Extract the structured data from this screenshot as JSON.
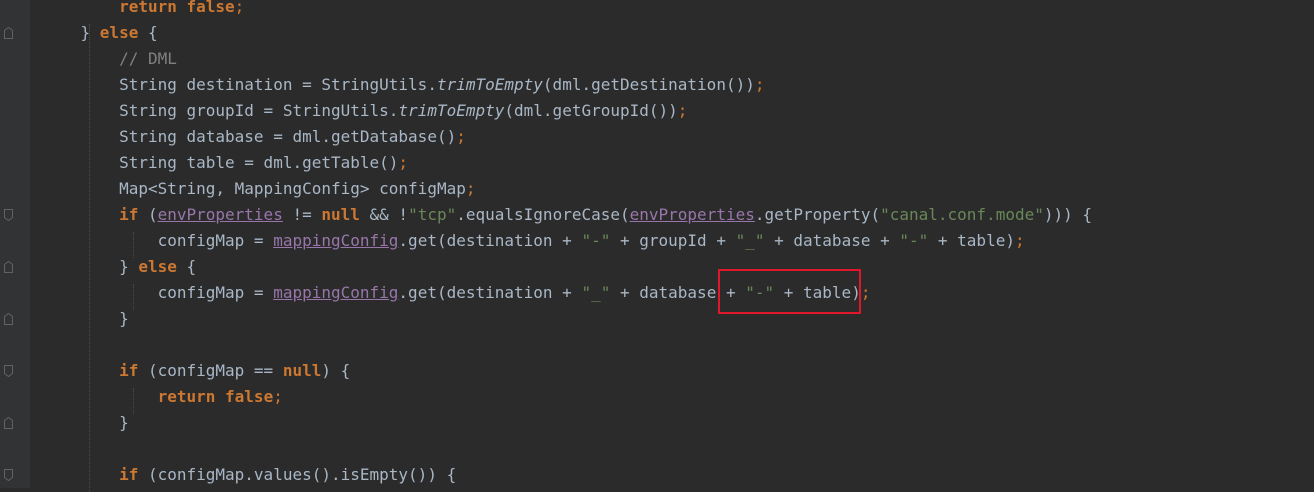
{
  "lines": [
    [
      {
        "t": "        "
      },
      {
        "t": "return",
        "c": "kw"
      },
      {
        "t": " "
      },
      {
        "t": "false",
        "c": "kw"
      },
      {
        "t": ";",
        "c": "semi"
      }
    ],
    [
      {
        "t": "    } "
      },
      {
        "t": "else",
        "c": "kw"
      },
      {
        "t": " {"
      }
    ],
    [
      {
        "t": "        "
      },
      {
        "t": "// DML",
        "c": "com"
      }
    ],
    [
      {
        "t": "        String destination = StringUtils."
      },
      {
        "t": "trimToEmpty",
        "c": "it"
      },
      {
        "t": "(dml.getDestination())"
      },
      {
        "t": ";",
        "c": "semi"
      }
    ],
    [
      {
        "t": "        String groupId = StringUtils."
      },
      {
        "t": "trimToEmpty",
        "c": "it"
      },
      {
        "t": "(dml.getGroupId())"
      },
      {
        "t": ";",
        "c": "semi"
      }
    ],
    [
      {
        "t": "        String database = dml.getDatabase()"
      },
      {
        "t": ";",
        "c": "semi"
      }
    ],
    [
      {
        "t": "        String table = dml.getTable()"
      },
      {
        "t": ";",
        "c": "semi"
      }
    ],
    [
      {
        "t": "        Map<String, MappingConfig> configMap"
      },
      {
        "t": ";",
        "c": "semi"
      }
    ],
    [
      {
        "t": "        "
      },
      {
        "t": "if",
        "c": "kw"
      },
      {
        "t": " ("
      },
      {
        "t": "envProperties",
        "c": "fld"
      },
      {
        "t": " != "
      },
      {
        "t": "null",
        "c": "kw"
      },
      {
        "t": " && !"
      },
      {
        "t": "\"tcp\"",
        "c": "str"
      },
      {
        "t": ".equalsIgnoreCase("
      },
      {
        "t": "envProperties",
        "c": "fld"
      },
      {
        "t": ".getProperty("
      },
      {
        "t": "\"canal.conf.mode\"",
        "c": "str"
      },
      {
        "t": "))) {"
      }
    ],
    [
      {
        "t": "            configMap = "
      },
      {
        "t": "mappingConfig",
        "c": "fld"
      },
      {
        "t": ".get(destination + "
      },
      {
        "t": "\"-\"",
        "c": "str"
      },
      {
        "t": " + groupId + "
      },
      {
        "t": "\"_\"",
        "c": "str"
      },
      {
        "t": " + database + "
      },
      {
        "t": "\"-\"",
        "c": "str"
      },
      {
        "t": " + table)"
      },
      {
        "t": ";",
        "c": "semi"
      }
    ],
    [
      {
        "t": "        } "
      },
      {
        "t": "else",
        "c": "kw"
      },
      {
        "t": " {"
      }
    ],
    [
      {
        "t": "            configMap = "
      },
      {
        "t": "mappingConfig",
        "c": "fld"
      },
      {
        "t": ".get(destination + "
      },
      {
        "t": "\"_\"",
        "c": "str"
      },
      {
        "t": " + database + "
      },
      {
        "t": "\"-\"",
        "c": "str"
      },
      {
        "t": " + table)"
      },
      {
        "t": ";",
        "c": "semi"
      }
    ],
    [
      {
        "t": "        }"
      }
    ],
    [],
    [
      {
        "t": "        "
      },
      {
        "t": "if",
        "c": "kw"
      },
      {
        "t": " (configMap == "
      },
      {
        "t": "null",
        "c": "kw"
      },
      {
        "t": ") {"
      }
    ],
    [
      {
        "t": "            "
      },
      {
        "t": "return",
        "c": "kw"
      },
      {
        "t": " "
      },
      {
        "t": "false",
        "c": "kw"
      },
      {
        "t": ";",
        "c": "semi"
      }
    ],
    [
      {
        "t": "        }"
      }
    ],
    [],
    [
      {
        "t": "        "
      },
      {
        "t": "if",
        "c": "kw"
      },
      {
        "t": " (configMap.values().isEmpty()) {"
      }
    ]
  ],
  "colors": {
    "background": "#2b2b2b",
    "gutter": "#313335",
    "text": "#a9b7c6",
    "keyword": "#cc7832",
    "comment": "#808080",
    "string": "#6a8759",
    "field": "#9876aa",
    "highlight_box": "#e0162b"
  }
}
